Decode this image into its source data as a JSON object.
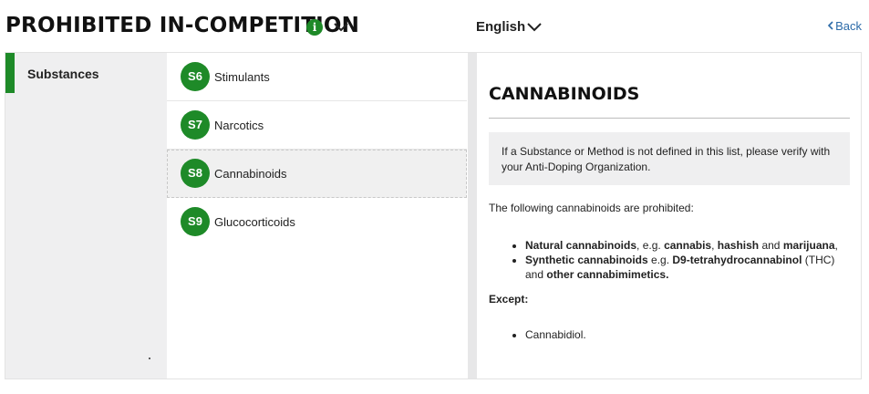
{
  "header": {
    "title": "PROHIBITED IN-COMPETITION",
    "info_glyph": "i",
    "language": "English",
    "back_label": "Back"
  },
  "sidebar": {
    "items": [
      {
        "label": "Substances",
        "active": true
      }
    ],
    "footer_mark": "."
  },
  "categories": [
    {
      "code": "S6",
      "label": "Stimulants",
      "active": false
    },
    {
      "code": "S7",
      "label": "Narcotics",
      "active": false
    },
    {
      "code": "S8",
      "label": "Cannabinoids",
      "active": true
    },
    {
      "code": "S9",
      "label": "Glucocorticoids",
      "active": false
    }
  ],
  "detail": {
    "title": "CANNABINOIDS",
    "notice": "If a Substance or Method is not defined in this list, please verify with your Anti-Doping Organization.",
    "intro": "The following cannabinoids are prohibited:",
    "item1": {
      "term": "Natural cannabinoids",
      "sep1": ", e.g. ",
      "ex1": "cannabis",
      "sep2": ", ",
      "ex2": "hashish",
      "sep3": " and ",
      "ex3": "marijuana",
      "end": ","
    },
    "item2": {
      "term": "Synthetic cannabinoids",
      "sep1": " e.g. ",
      "ex1": "D9-tetrahydrocannabinol",
      "sep2": " (THC) and ",
      "ex2": "other cannabimimetics.",
      "end": ""
    },
    "except_label": "Except:",
    "except_items": [
      "Cannabidiol."
    ]
  },
  "colors": {
    "accent": "#1e8a28",
    "link": "#2b6aa8",
    "panel_gray": "#efeff0"
  },
  "icons": {
    "info": "info-icon",
    "title_dropdown": "chevron-down-icon",
    "language_dropdown": "chevron-down-icon",
    "back": "chevron-left-icon"
  }
}
